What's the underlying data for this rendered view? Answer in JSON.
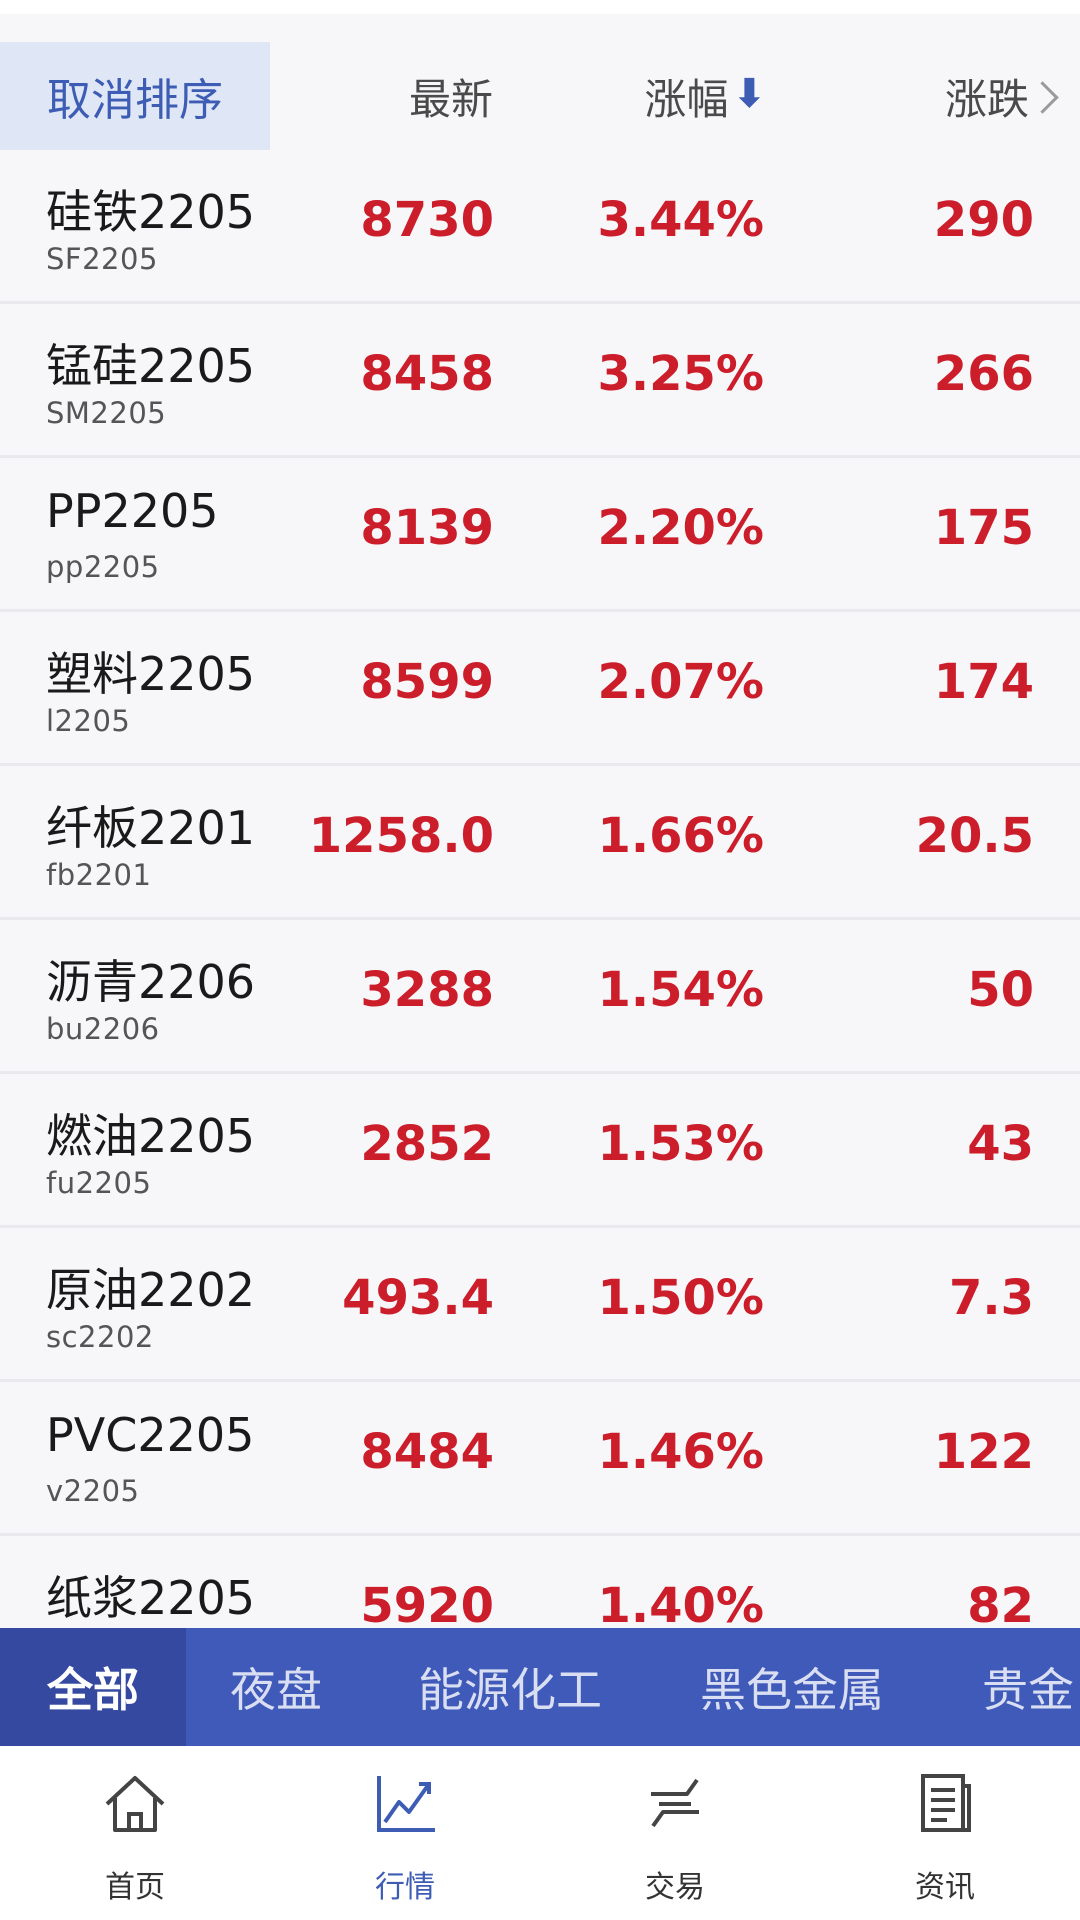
{
  "header": {
    "cancel_sort": "取消排序",
    "col_latest": "最新",
    "col_change_pct": "涨幅",
    "col_change": "涨跌",
    "sort_arrow": "⬇"
  },
  "rows": [
    {
      "name": "硅铁2205",
      "code": "SF2205",
      "latest": "8730",
      "change_pct": "3.44%",
      "change": "290"
    },
    {
      "name": "锰硅2205",
      "code": "SM2205",
      "latest": "8458",
      "change_pct": "3.25%",
      "change": "266"
    },
    {
      "name": "PP2205",
      "code": "pp2205",
      "latest": "8139",
      "change_pct": "2.20%",
      "change": "175"
    },
    {
      "name": "塑料2205",
      "code": "l2205",
      "latest": "8599",
      "change_pct": "2.07%",
      "change": "174"
    },
    {
      "name": "纤板2201",
      "code": "fb2201",
      "latest": "1258.0",
      "change_pct": "1.66%",
      "change": "20.5"
    },
    {
      "name": "沥青2206",
      "code": "bu2206",
      "latest": "3288",
      "change_pct": "1.54%",
      "change": "50"
    },
    {
      "name": "燃油2205",
      "code": "fu2205",
      "latest": "2852",
      "change_pct": "1.53%",
      "change": "43"
    },
    {
      "name": "原油2202",
      "code": "sc2202",
      "latest": "493.4",
      "change_pct": "1.50%",
      "change": "7.3"
    },
    {
      "name": "PVC2205",
      "code": "v2205",
      "latest": "8484",
      "change_pct": "1.46%",
      "change": "122"
    },
    {
      "name": "纸浆2205",
      "code": "",
      "latest": "5920",
      "change_pct": "1.40%",
      "change": "82"
    }
  ],
  "categories": [
    "全部",
    "夜盘",
    "能源化工",
    "黑色金属",
    "贵金"
  ],
  "nav": {
    "home": "首页",
    "market": "行情",
    "trade": "交易",
    "news": "资讯"
  },
  "colors": {
    "up": "#cc1d2b",
    "accent": "#3d5cb4",
    "tab_bar": "#3f5ab8"
  }
}
